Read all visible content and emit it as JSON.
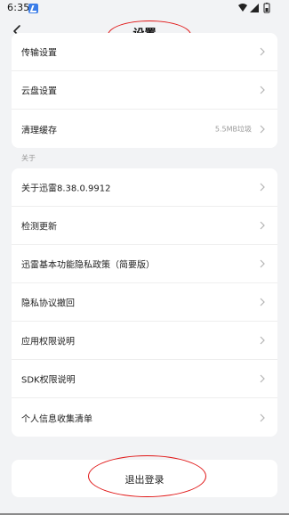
{
  "status_bar": {
    "time": "6:35"
  },
  "header": {
    "title": "设置"
  },
  "top_card": {
    "items": [
      {
        "label": "传输设置",
        "value": ""
      },
      {
        "label": "云盘设置",
        "value": ""
      },
      {
        "label": "清理缓存",
        "value": "5.5MB垃圾"
      }
    ]
  },
  "about_section": {
    "title": "关于",
    "items": [
      {
        "label": "关于迅雷8.38.0.9912"
      },
      {
        "label": "检测更新"
      },
      {
        "label": "迅雷基本功能隐私政策（简要版）"
      },
      {
        "label": "隐私协议撤回"
      },
      {
        "label": "应用权限说明"
      },
      {
        "label": "SDK权限说明"
      },
      {
        "label": "个人信息收集清单"
      }
    ]
  },
  "logout": {
    "label": "退出登录"
  },
  "colors": {
    "annotation": "#e01515",
    "background": "#f2f3f5",
    "card": "#ffffff"
  }
}
